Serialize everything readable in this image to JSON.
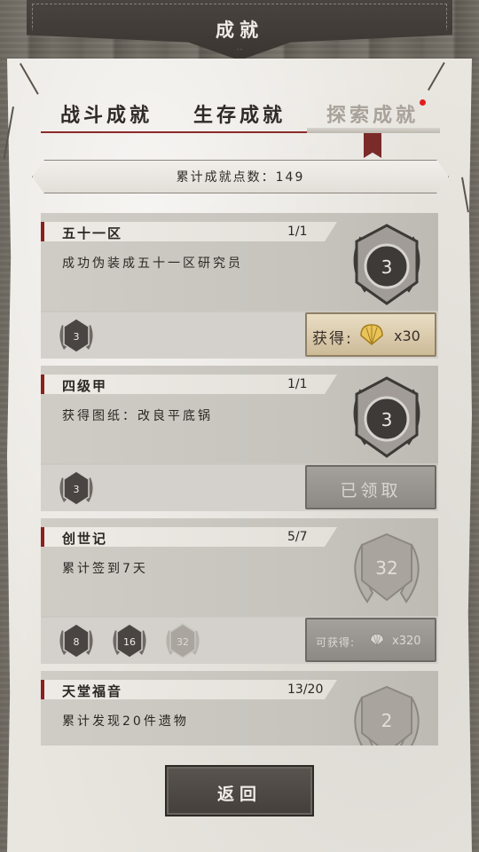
{
  "header": {
    "title": "成就"
  },
  "tabs": [
    {
      "label": "战斗成就",
      "active": false
    },
    {
      "label": "生存成就",
      "active": false
    },
    {
      "label": "探索成就",
      "active": true,
      "has_notification": true
    }
  ],
  "points": {
    "text": "累计成就点数：149"
  },
  "achievements": [
    {
      "title": "五十一区",
      "progress": "1/1",
      "description": "成功伪装成五十一区研究员",
      "medal_value": "3",
      "tier_values": [
        "3"
      ],
      "status": "claimable",
      "reward_label": "获得:",
      "reward_icon": "shell-icon",
      "reward_count": "x30"
    },
    {
      "title": "四级甲",
      "progress": "1/1",
      "description": "获得图纸：改良平底锅",
      "medal_value": "3",
      "tier_values": [
        "3"
      ],
      "status": "claimed",
      "claimed_label": "已领取"
    },
    {
      "title": "创世记",
      "progress": "5/7",
      "description": "累计签到7天",
      "medal_value": "32",
      "tier_values": [
        "8",
        "16",
        "32"
      ],
      "status": "in_progress",
      "reward_label": "可获得:",
      "reward_icon": "shell-icon",
      "reward_count": "x320"
    },
    {
      "title": "天堂福音",
      "progress": "13/20",
      "description": "累计发现20件遗物",
      "medal_value": "2",
      "status": "in_progress"
    }
  ],
  "footer": {
    "back_label": "返回"
  },
  "colors": {
    "accent_red": "#8d1f1f",
    "notification": "#e21d1d",
    "paper": "#e9e6e0"
  }
}
